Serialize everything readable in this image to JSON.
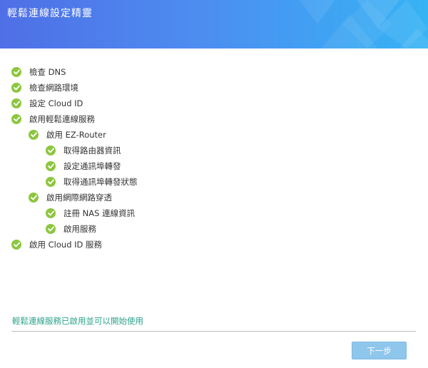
{
  "wizard": {
    "title": "輕鬆連線設定精靈"
  },
  "steps": [
    {
      "label": "檢查 DNS",
      "level": 0,
      "status": "done"
    },
    {
      "label": "檢查網路環境",
      "level": 0,
      "status": "done"
    },
    {
      "label": "設定 Cloud ID",
      "level": 0,
      "status": "done"
    },
    {
      "label": "啟用輕鬆連線服務",
      "level": 0,
      "status": "done"
    },
    {
      "label": "啟用 EZ-Router",
      "level": 1,
      "status": "done"
    },
    {
      "label": "取得路由器資訊",
      "level": 2,
      "status": "done"
    },
    {
      "label": "設定通訊埠轉發",
      "level": 2,
      "status": "done"
    },
    {
      "label": "取得通訊埠轉發狀態",
      "level": 2,
      "status": "done"
    },
    {
      "label": "啟用網際網路穿透",
      "level": 1,
      "status": "done"
    },
    {
      "label": "註冊 NAS 連線資訊",
      "level": 2,
      "status": "done"
    },
    {
      "label": "啟用服務",
      "level": 2,
      "status": "done"
    },
    {
      "label": "啟用 Cloud ID 服務",
      "level": 0,
      "status": "done"
    }
  ],
  "status_message": "輕鬆連線服務已啟用並可以開始使用",
  "buttons": {
    "next_label": "下一步"
  },
  "colors": {
    "check": "#8dc63f",
    "status_text": "#2aa38c",
    "next_button": "#8fc6ec"
  }
}
